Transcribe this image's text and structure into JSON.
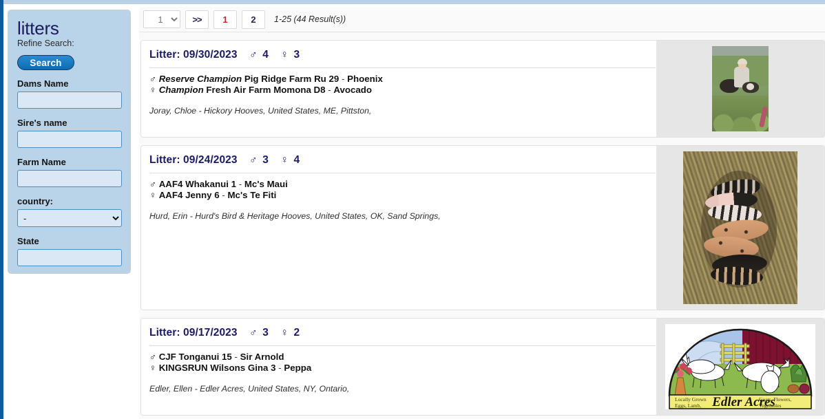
{
  "theme": {
    "accent_blue": "#11599c",
    "sidebar_bg": "#b9d3e8",
    "title_navy": "#1a1a66",
    "active_page_red": "#cf2020",
    "image_panel_gray": "#e6e6e6"
  },
  "sidebar": {
    "title": "litters",
    "refine_label": "Refine Search:",
    "search_button": "Search",
    "fields": [
      {
        "label": "Dams Name",
        "value": "",
        "placeholder": "",
        "type": "text",
        "name": "dams-name"
      },
      {
        "label": "Sire's name",
        "value": "",
        "placeholder": "",
        "type": "text",
        "name": "sires-name"
      },
      {
        "label": "Farm Name",
        "value": "",
        "placeholder": "",
        "type": "text",
        "name": "farm-name"
      },
      {
        "label": "country:",
        "value": "-",
        "options": [
          "-"
        ],
        "type": "select",
        "name": "country"
      },
      {
        "label": "State",
        "value": "",
        "placeholder": "",
        "type": "text",
        "name": "state"
      }
    ]
  },
  "pager": {
    "page_select_value": "1",
    "page_select_options": [
      "1",
      "2"
    ],
    "next_label": ">>",
    "pages": [
      {
        "label": "1",
        "active": true
      },
      {
        "label": "2",
        "active": false
      }
    ],
    "result_info": "1-25 (44 Result(s))"
  },
  "litters": [
    {
      "title_label": "Litter:",
      "date": "09/30/2023",
      "male_symbol": "♂",
      "male_count": "4",
      "female_symbol": "♀",
      "female_count": "3",
      "sire": {
        "symbol": "♂",
        "award": "Reserve Champion",
        "registered_name": "Pig Ridge Farm Ru 29",
        "dash": "-",
        "call_name": "Phoenix"
      },
      "dam": {
        "symbol": "♀",
        "award": "Champion",
        "registered_name": "Fresh Air Farm Momona D8",
        "dash": "-",
        "call_name": "Avocado"
      },
      "breeder": "Joray, Chloe - Hickory Hooves, United States, ME, Pittston,",
      "image_kind": "photo-garden",
      "image_alt": "Child kneeling in garden with two black piglets"
    },
    {
      "title_label": "Litter:",
      "date": "09/24/2023",
      "male_symbol": "♂",
      "male_count": "3",
      "female_symbol": "♀",
      "female_count": "4",
      "sire": {
        "symbol": "♂",
        "award": "",
        "registered_name": "AAF4 Whakanui 1",
        "dash": "-",
        "call_name": "Mc's Maui"
      },
      "dam": {
        "symbol": "♀",
        "award": "",
        "registered_name": "AAF4 Jenny 6",
        "dash": "-",
        "call_name": "Mc's Te Fiti"
      },
      "breeder": "Hurd, Erin - Hurd's Bird & Heritage Hooves, United States, OK, Sand Springs,",
      "image_kind": "photo-straw",
      "image_alt": "Six newborn spotted piglets lying on straw"
    },
    {
      "title_label": "Litter:",
      "date": "09/17/2023",
      "male_symbol": "♂",
      "male_count": "3",
      "female_symbol": "♀",
      "female_count": "2",
      "sire": {
        "symbol": "♂",
        "award": "",
        "registered_name": "CJF Tonganui 15",
        "dash": "-",
        "call_name": "Sir Arnold"
      },
      "dam": {
        "symbol": "♀",
        "award": "",
        "registered_name": "KINGSRUN Wilsons Gina 3",
        "dash": "-",
        "call_name": "Peppa"
      },
      "breeder": "Edler, Ellen - Edler Acres, United States, NY, Ontario,",
      "image_kind": "logo-edler",
      "image_alt": "Edler Acres farm logo",
      "logo": {
        "farm_name": "Edler Acres",
        "left_text_line1": "Locally Grown",
        "left_text_line2": "Eggs, Lamb,",
        "right_text_line1": "Goats, Flowers,",
        "right_text_line2": "Vegetables"
      }
    }
  ]
}
